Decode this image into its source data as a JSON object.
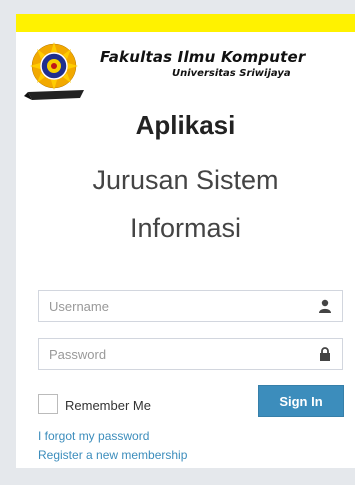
{
  "header": {
    "faculty_name": "Fakultas Ilmu Komputer",
    "university_name": "Universitas Sriwijaya",
    "accent_color": "#fff200"
  },
  "app": {
    "title": "Aplikasi",
    "subtitle": "Jurusan Sistem Informasi"
  },
  "login": {
    "username_placeholder": "Username",
    "username_value": "",
    "password_placeholder": "Password",
    "password_value": "",
    "remember_label": "Remember Me",
    "remember_checked": false,
    "signin_label": "Sign In",
    "signin_color": "#3c8dbc",
    "username_icon": "user-icon",
    "password_icon": "lock-icon"
  },
  "links": {
    "forgot_password": "I forgot my password",
    "register": "Register a new membership"
  }
}
